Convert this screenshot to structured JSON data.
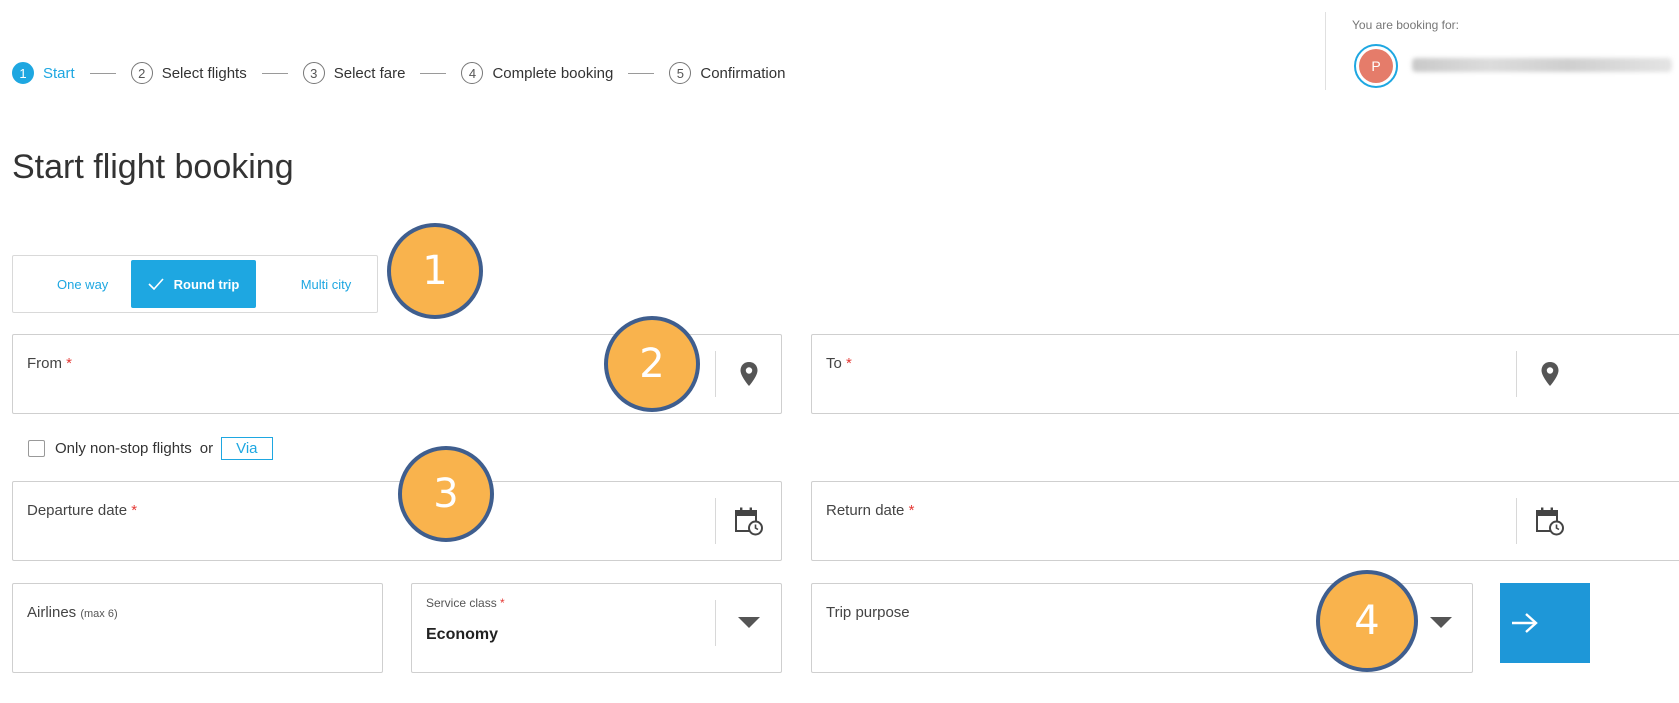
{
  "stepper": {
    "steps": [
      {
        "number": "1",
        "label": "Start",
        "active": true
      },
      {
        "number": "2",
        "label": "Select flights",
        "active": false
      },
      {
        "number": "3",
        "label": "Select fare",
        "active": false
      },
      {
        "number": "4",
        "label": "Complete booking",
        "active": false
      },
      {
        "number": "5",
        "label": "Confirmation",
        "active": false
      }
    ]
  },
  "booking_for": {
    "label": "You are booking for:",
    "avatar_initial": "P"
  },
  "page_title": "Start flight booking",
  "trip_type": {
    "options": [
      "One way",
      "Round trip",
      "Multi city"
    ],
    "selected": "Round trip"
  },
  "from": {
    "label": "From",
    "required_mark": "*",
    "icon": "map-pin-icon"
  },
  "to": {
    "label": "To",
    "required_mark": "*",
    "icon": "map-pin-icon"
  },
  "nonstop": {
    "label": "Only non-stop flights",
    "or_text": "or",
    "via_label": "Via",
    "checked": false
  },
  "departure_date": {
    "label": "Departure date",
    "required_mark": "*",
    "icon": "calendar-clock-icon"
  },
  "return_date": {
    "label": "Return date",
    "required_mark": "*",
    "icon": "calendar-clock-icon"
  },
  "airlines": {
    "label": "Airlines",
    "hint": "(max 6)"
  },
  "service_class": {
    "label": "Service class",
    "required_mark": "*",
    "value": "Economy"
  },
  "trip_purpose": {
    "label": "Trip purpose"
  },
  "markers": [
    "1",
    "2",
    "3",
    "4"
  ],
  "colors": {
    "accent": "#1ea7e1",
    "button": "#1e97d8",
    "required": "#e53935",
    "marker_fill": "#f9b34d",
    "marker_border": "#3f5e8e"
  }
}
